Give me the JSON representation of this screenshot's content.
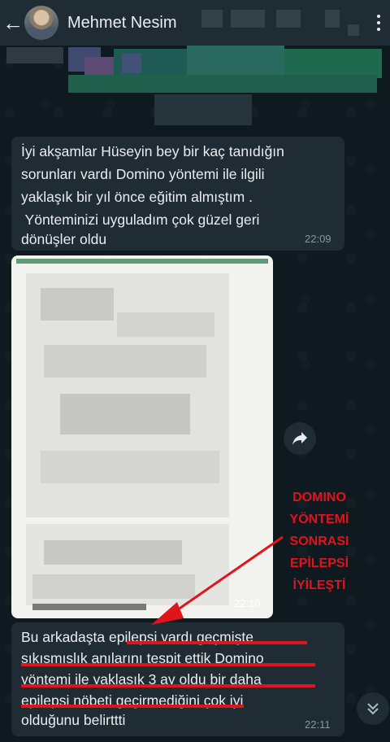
{
  "header": {
    "back_icon": "arrow-left-icon",
    "contact_name": "Mehmet Nesim",
    "menu_icon": "more-vertical-icon"
  },
  "messages": [
    {
      "type": "text",
      "lines": [
        "İyi akşamlar Hüseyin bey bir kaç tanıdığın",
        "sorunları vardı Domino yöntemi ile ilgili",
        "yaklaşık bir yıl önce eğitim almıştım .",
        " Yönteminizi uyguladım çok güzel geri",
        "dönüşler oldu"
      ],
      "time": "22:09"
    },
    {
      "type": "image",
      "time": "22:10",
      "forward_icon": "share-arrow-icon"
    },
    {
      "type": "text",
      "lines": [
        "Bu arkadaşta epilepsi vardı geçmişte",
        "sıkışmışlık anılarını tespit ettik Domino",
        "yöntemi ile yaklaşık 3 ay oldu bir daha",
        "epilepsi nöbeti geçirmediğini çok iyi",
        "olduğunu belirttti"
      ],
      "time": "22:11"
    }
  ],
  "annotation": {
    "lines": [
      "DOMINO",
      "YÖNTEMİ",
      "SONRASI",
      "EPİLEPSİ",
      "İYİLEŞTİ"
    ],
    "color": "#e0141c"
  },
  "scroll_down_icon": "double-chevron-down-icon",
  "colors": {
    "background": "#0e1a20",
    "header": "#1f2c33",
    "bubble": "#202c33",
    "timestamp": "#8696a0",
    "annotation_red": "#e0141c"
  }
}
